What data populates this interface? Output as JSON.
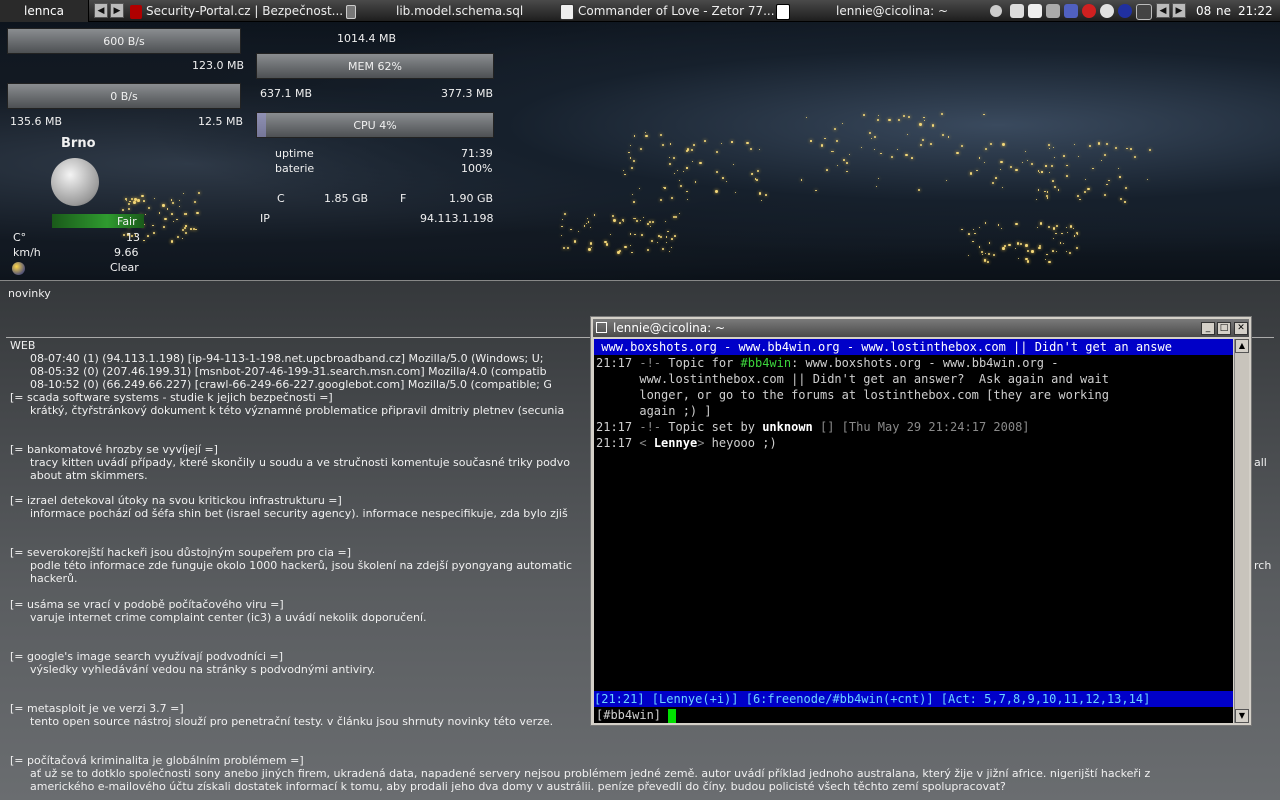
{
  "colors": {
    "accent": "#0000c8",
    "cursor": "#00e000",
    "weather_bar": "#2f9b2f"
  },
  "taskbar": {
    "workspace": "lennca",
    "tasks": [
      {
        "label": "Security-Portal.cz | Bezpečnost...",
        "icon": "red-shield-icon"
      },
      {
        "label": "lib.model.schema.sql",
        "icon": "file-icon"
      },
      {
        "label": "Commander of Love - Zetor 77...",
        "icon": "media-icon"
      },
      {
        "label": "lennie@cicolina: ~",
        "icon": "terminal-icon"
      }
    ],
    "clock": {
      "day": "08",
      "weekday": "ne",
      "time": "21:22"
    }
  },
  "conky": {
    "net_down_rate": "600 B/s",
    "net_down_total": "123.0 MB",
    "net_up_rate": "0 B/s",
    "net_up_left": "135.6 MB",
    "net_up_total": "12.5 MB",
    "mem_total": "1014.4 MB",
    "mem_label": "MEM 62%",
    "mem_percent": 62,
    "mem_used": "637.1 MB",
    "mem_free": "377.3 MB",
    "cpu_label": "CPU 4%",
    "cpu_percent": 4,
    "uptime_label": "uptime",
    "uptime_value": "71:39",
    "battery_label": "baterie",
    "battery_value": "100%",
    "disk_c_label": "C",
    "disk_c_value": "1.85 GB",
    "disk_f_label": "F",
    "disk_f_value": "1.90 GB",
    "ip_label": "IP",
    "ip_value": "94.113.1.198"
  },
  "weather": {
    "city": "Brno",
    "condition_bar": "Fair",
    "temp_label": "C°",
    "temp_value": "13",
    "wind_label": "km/h",
    "wind_value": "9.66",
    "sky": "Clear"
  },
  "news": {
    "title": "novinky",
    "web_header": "WEB",
    "web_log": [
      "08-07:40  (1)  (94.113.1.198)  [ip-94-113-1-198.net.upcbroadband.cz]    Mozilla/5.0 (Windows; U;",
      "08-05:32  (0)  (207.46.199.31)  [msnbot-207-46-199-31.search.msn.com]    Mozilla/4.0 (compatib",
      "08-10:52  (0)  (66.249.66.227)  [crawl-66-249-66-227.googlebot.com]    Mozilla/5.0 (compatible; G"
    ],
    "items": [
      {
        "h": "[= scada software systems - studie k jejich bezpečnosti =]",
        "b": [
          "krátký, čtyřstránkový dokument k této významné problematice připravil dmitriy pletnev (secunia"
        ]
      },
      {
        "h": "[= bankomatové hrozby se vyvíjejí =]",
        "b": [
          "tracy kitten uvádí případy, které skončily u soudu a ve stručnosti komentuje současné triky podvo",
          "about atm skimmers."
        ],
        "r": "all"
      },
      {
        "h": "[= izrael detekoval útoky na svou kritickou infrastrukturu =]",
        "b": [
          "informace pochází od šéfa shin bet (israel security agency). informace nespecifikuje, zda bylo zjiš"
        ]
      },
      {
        "h": "[= severokorejští hackeři jsou důstojným soupeřem pro cia =]",
        "b": [
          "podle této informace zde funguje okolo 1000 hackerů, jsou školení na zdejší pyongyang automatic",
          "hackerů."
        ],
        "r": "rch"
      },
      {
        "h": "[= usáma se vrací v podobě počítačového viru =]",
        "b": [
          "varuje internet crime complaint center (ic3) a uvádí nekolik doporučení."
        ]
      },
      {
        "h": "[= google's image search využívají podvodníci =]",
        "b": [
          "výsledky vyhledávání vedou na stránky s podvodnými antiviry."
        ]
      },
      {
        "h": "[= metasploit je ve verzi 3.7 =]",
        "b": [
          "tento open source nástroj slouží pro penetrační testy. v článku jsou shrnuty novinky této verze."
        ]
      },
      {
        "h": "[= počítačová kriminalita je globálním problémem =]",
        "b": [
          "ať už se to dotklo společnosti sony anebo jiných firem, ukradená data, napadené servery nejsou problémem jedné země. autor uvádí příklad jednoho australana, který žije v jižní africe. nigerijští hackeři z",
          "amerického e-mailového účtu získali dostatek informací k tomu, aby prodali jeho dva domy v austrálii. peníze převedli do číny. budou policisté všech těchto zemí spolupracovat?"
        ]
      }
    ]
  },
  "terminal": {
    "title": "lennie@cicolina: ~",
    "topic_bar": " www.boxshots.org - www.bb4win.org - www.lostinthebox.com || Didn't get an answe",
    "lines": [
      {
        "time": "21:17",
        "mark": "-!-",
        "pre": " Topic for ",
        "chan": "#bb4win",
        "post": ": www.boxshots.org - www.bb4win.org -"
      },
      {
        "cont": "      www.lostinthebox.com || Didn't get an answer?  Ask again and wait"
      },
      {
        "cont": "      longer, or go to the forums at lostinthebox.com [they are working"
      },
      {
        "cont": "      again ;) ]"
      },
      {
        "time": "21:17",
        "mark": "-!-",
        "pre": " Topic set by ",
        "nick": "unknown",
        "post": " [] [Thu May 29 21:24:17 2008]"
      },
      {
        "time": "21:17",
        "lt": "<",
        "nick": "Lennye",
        "gt": ">",
        "msg": " heyooo ;)"
      }
    ],
    "status_bar": "[21:21] [Lennye(+i)] [6:freenode/#bb4win(+cnt)] [Act: 5,7,8,9,10,11,12,13,14]",
    "prompt": "[#bb4win] "
  }
}
